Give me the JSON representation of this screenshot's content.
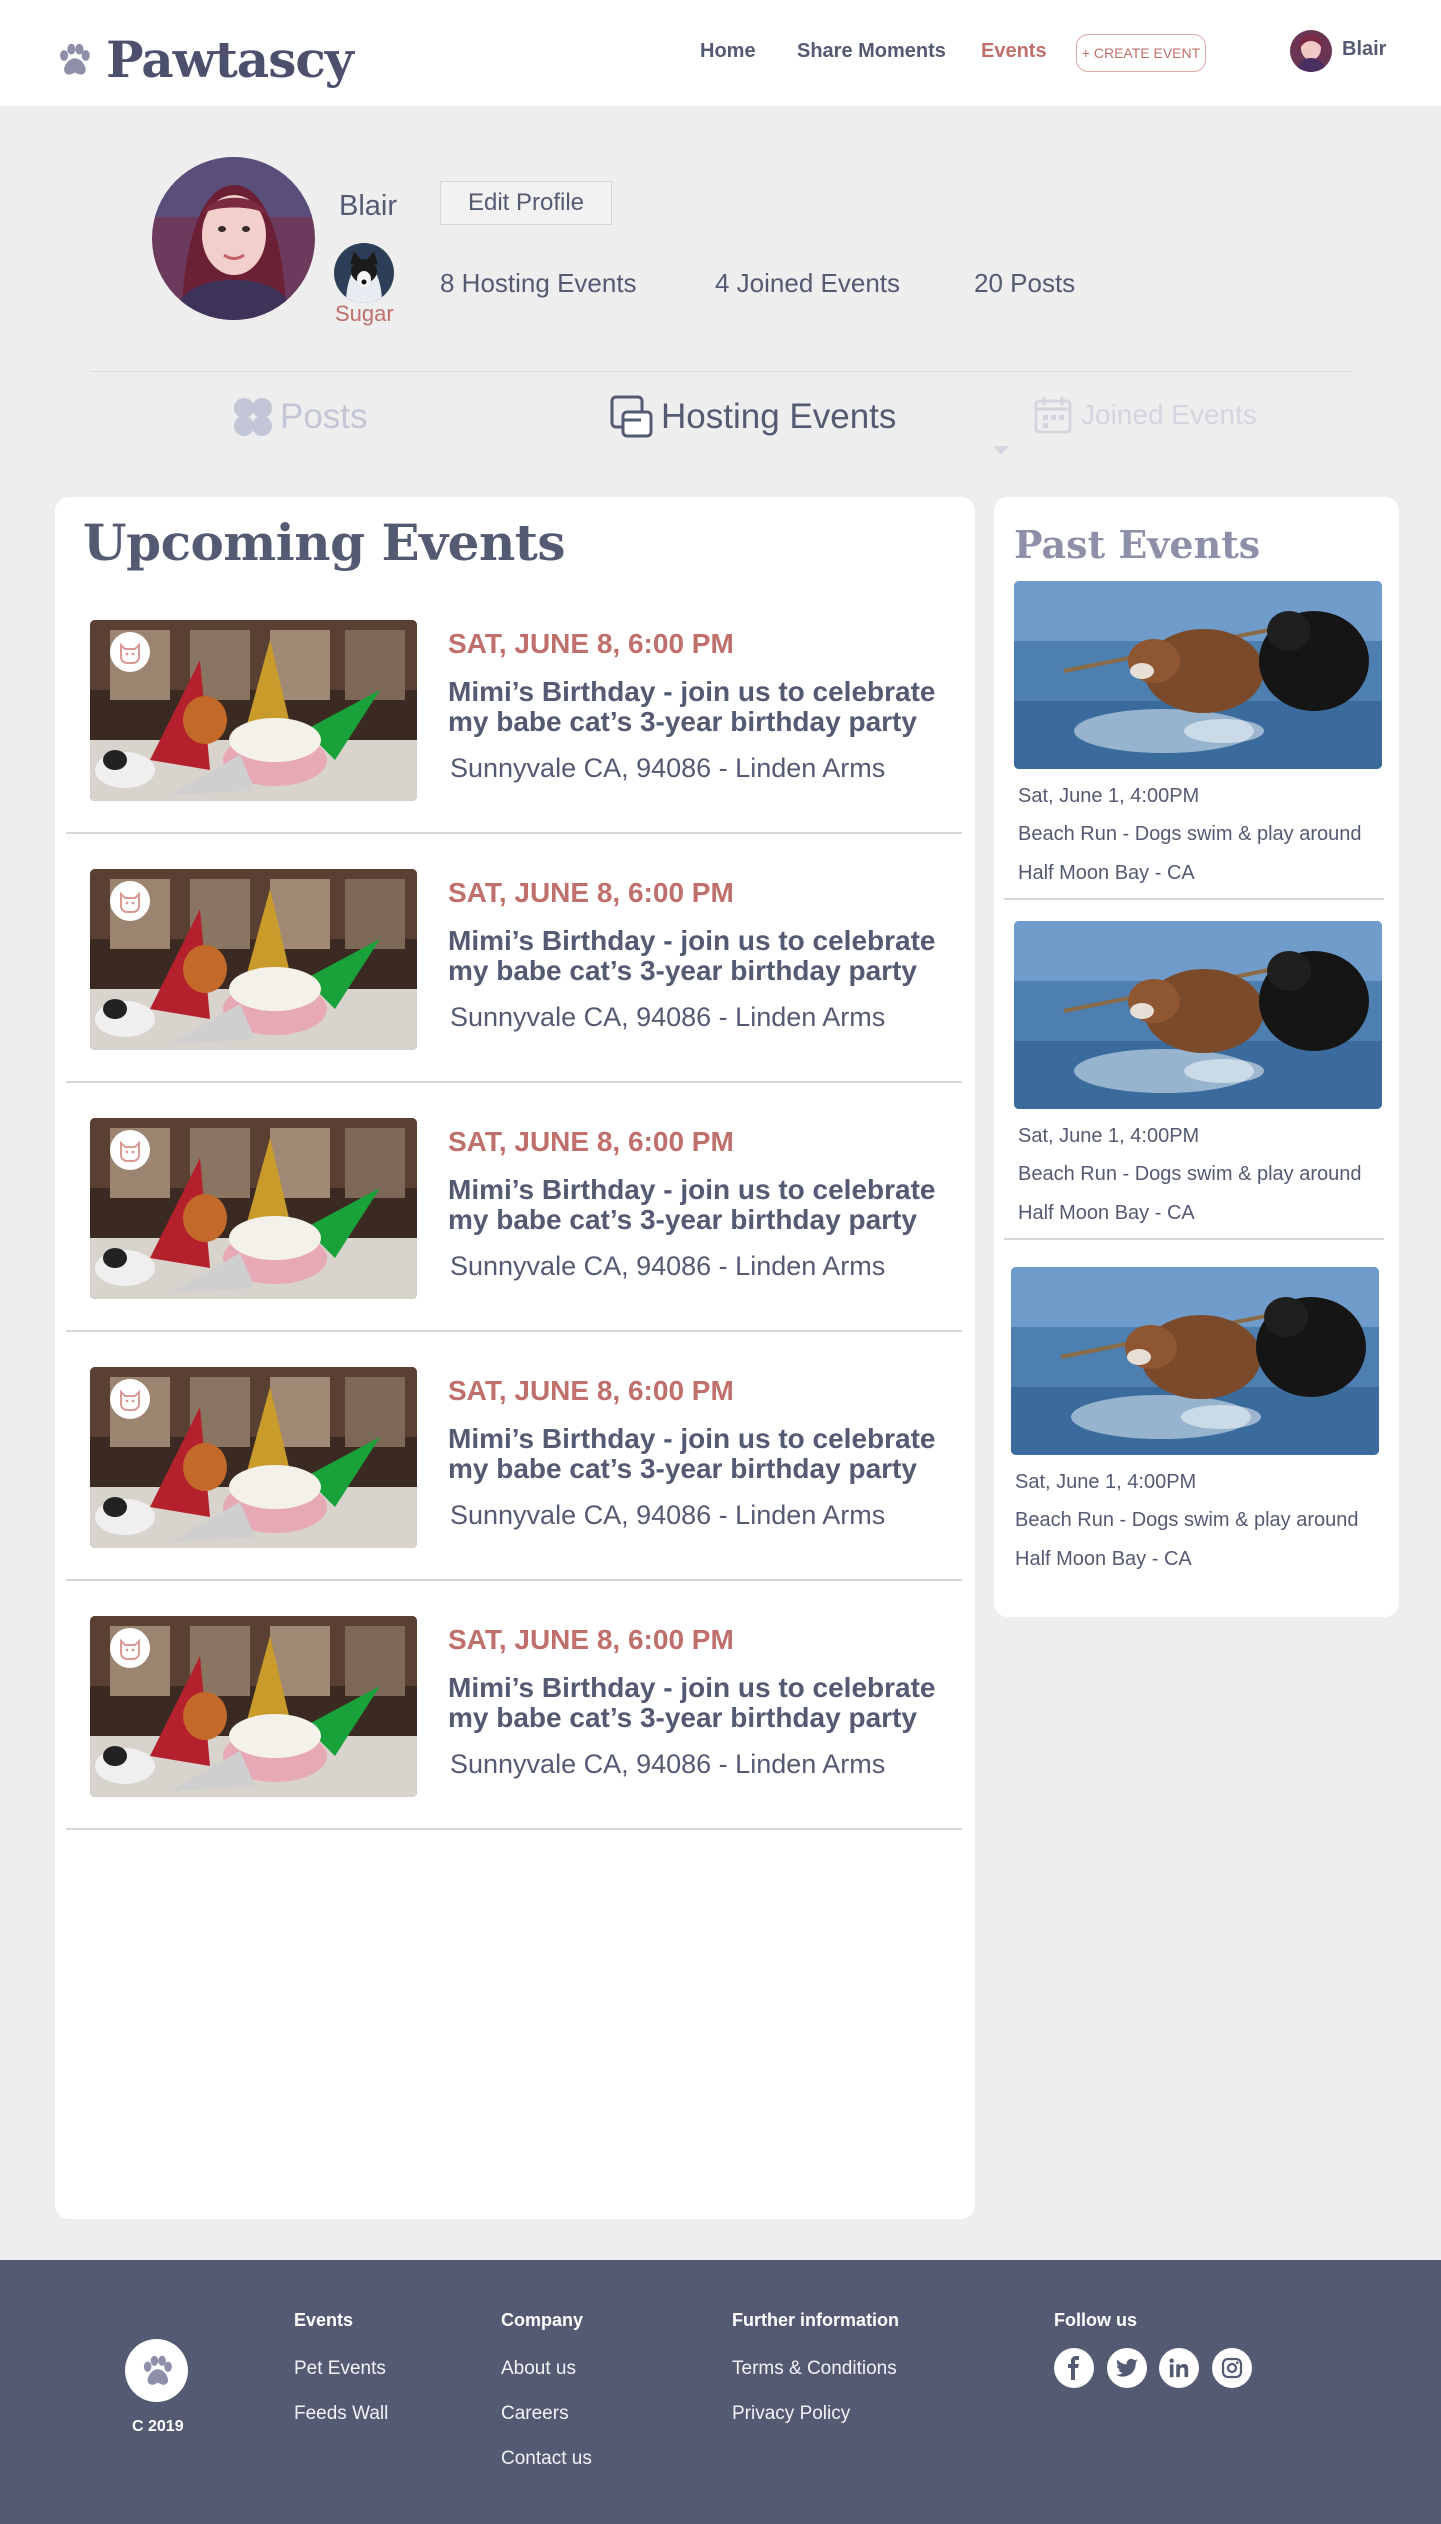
{
  "header": {
    "brand": "Pawtascy",
    "nav": {
      "home": "Home",
      "share": "Share Moments",
      "events": "Events"
    },
    "create_event": "+ CREATE EVENT",
    "user": "Blair"
  },
  "profile": {
    "name": "Blair",
    "edit_label": "Edit Profile",
    "pet_name": "Sugar",
    "stats": {
      "hosting": "8 Hosting Events",
      "joined": "4 Joined Events",
      "posts": "20 Posts"
    }
  },
  "tabs": {
    "posts": "Posts",
    "hosting": "Hosting Events",
    "joined": "Joined Events"
  },
  "upcoming": {
    "title": "Upcoming Events",
    "events": [
      {
        "date": "SAT, JUNE 8,  6:00 PM",
        "title": "Mimi’s Birthday - join us to celebrate my babe cat’s 3-year birthday party",
        "location": "Sunnyvale  CA, 94086 - Linden Arms"
      },
      {
        "date": "SAT, JUNE 8,  6:00 PM",
        "title": "Mimi’s Birthday - join us to celebrate my babe cat’s 3-year birthday party",
        "location": "Sunnyvale  CA, 94086 - Linden Arms"
      },
      {
        "date": "SAT, JUNE 8,  6:00 PM",
        "title": "Mimi’s Birthday - join us to celebrate my babe cat’s 3-year birthday party",
        "location": "Sunnyvale  CA, 94086 - Linden Arms"
      },
      {
        "date": "SAT, JUNE 8,  6:00 PM",
        "title": "Mimi’s Birthday - join us to celebrate my babe cat’s 3-year birthday party",
        "location": "Sunnyvale  CA, 94086 - Linden Arms"
      },
      {
        "date": "SAT, JUNE 8,  6:00 PM",
        "title": "Mimi’s Birthday - join us to celebrate my babe cat’s 3-year birthday party",
        "location": "Sunnyvale  CA, 94086 - Linden Arms"
      }
    ]
  },
  "past": {
    "title": "Past Events",
    "events": [
      {
        "date": "Sat, June 1, 4:00PM",
        "title": "Beach Run - Dogs swim & play around",
        "location": "Half Moon Bay - CA"
      },
      {
        "date": "Sat, June 1, 4:00PM",
        "title": "Beach Run - Dogs swim & play around",
        "location": "Half Moon Bay - CA"
      },
      {
        "date": "Sat, June 1, 4:00PM",
        "title": "Beach Run - Dogs swim & play around",
        "location": "Half Moon Bay - CA"
      }
    ]
  },
  "footer": {
    "copyright": "C 2019",
    "events": {
      "heading": "Events",
      "links": [
        "Pet Events",
        "Feeds Wall"
      ]
    },
    "company": {
      "heading": "Company",
      "links": [
        "About us",
        "Careers",
        "Contact us"
      ]
    },
    "info": {
      "heading": "Further information",
      "links": [
        "Terms & Conditions",
        "Privacy Policy"
      ]
    },
    "follow": {
      "heading": "Follow us",
      "icons": [
        "facebook-icon",
        "twitter-icon",
        "linkedin-icon",
        "instagram-icon"
      ]
    }
  },
  "colors": {
    "accent": "#c0706c",
    "primary": "#555a73",
    "background": "#eeeeee",
    "footer": "#555a73"
  }
}
